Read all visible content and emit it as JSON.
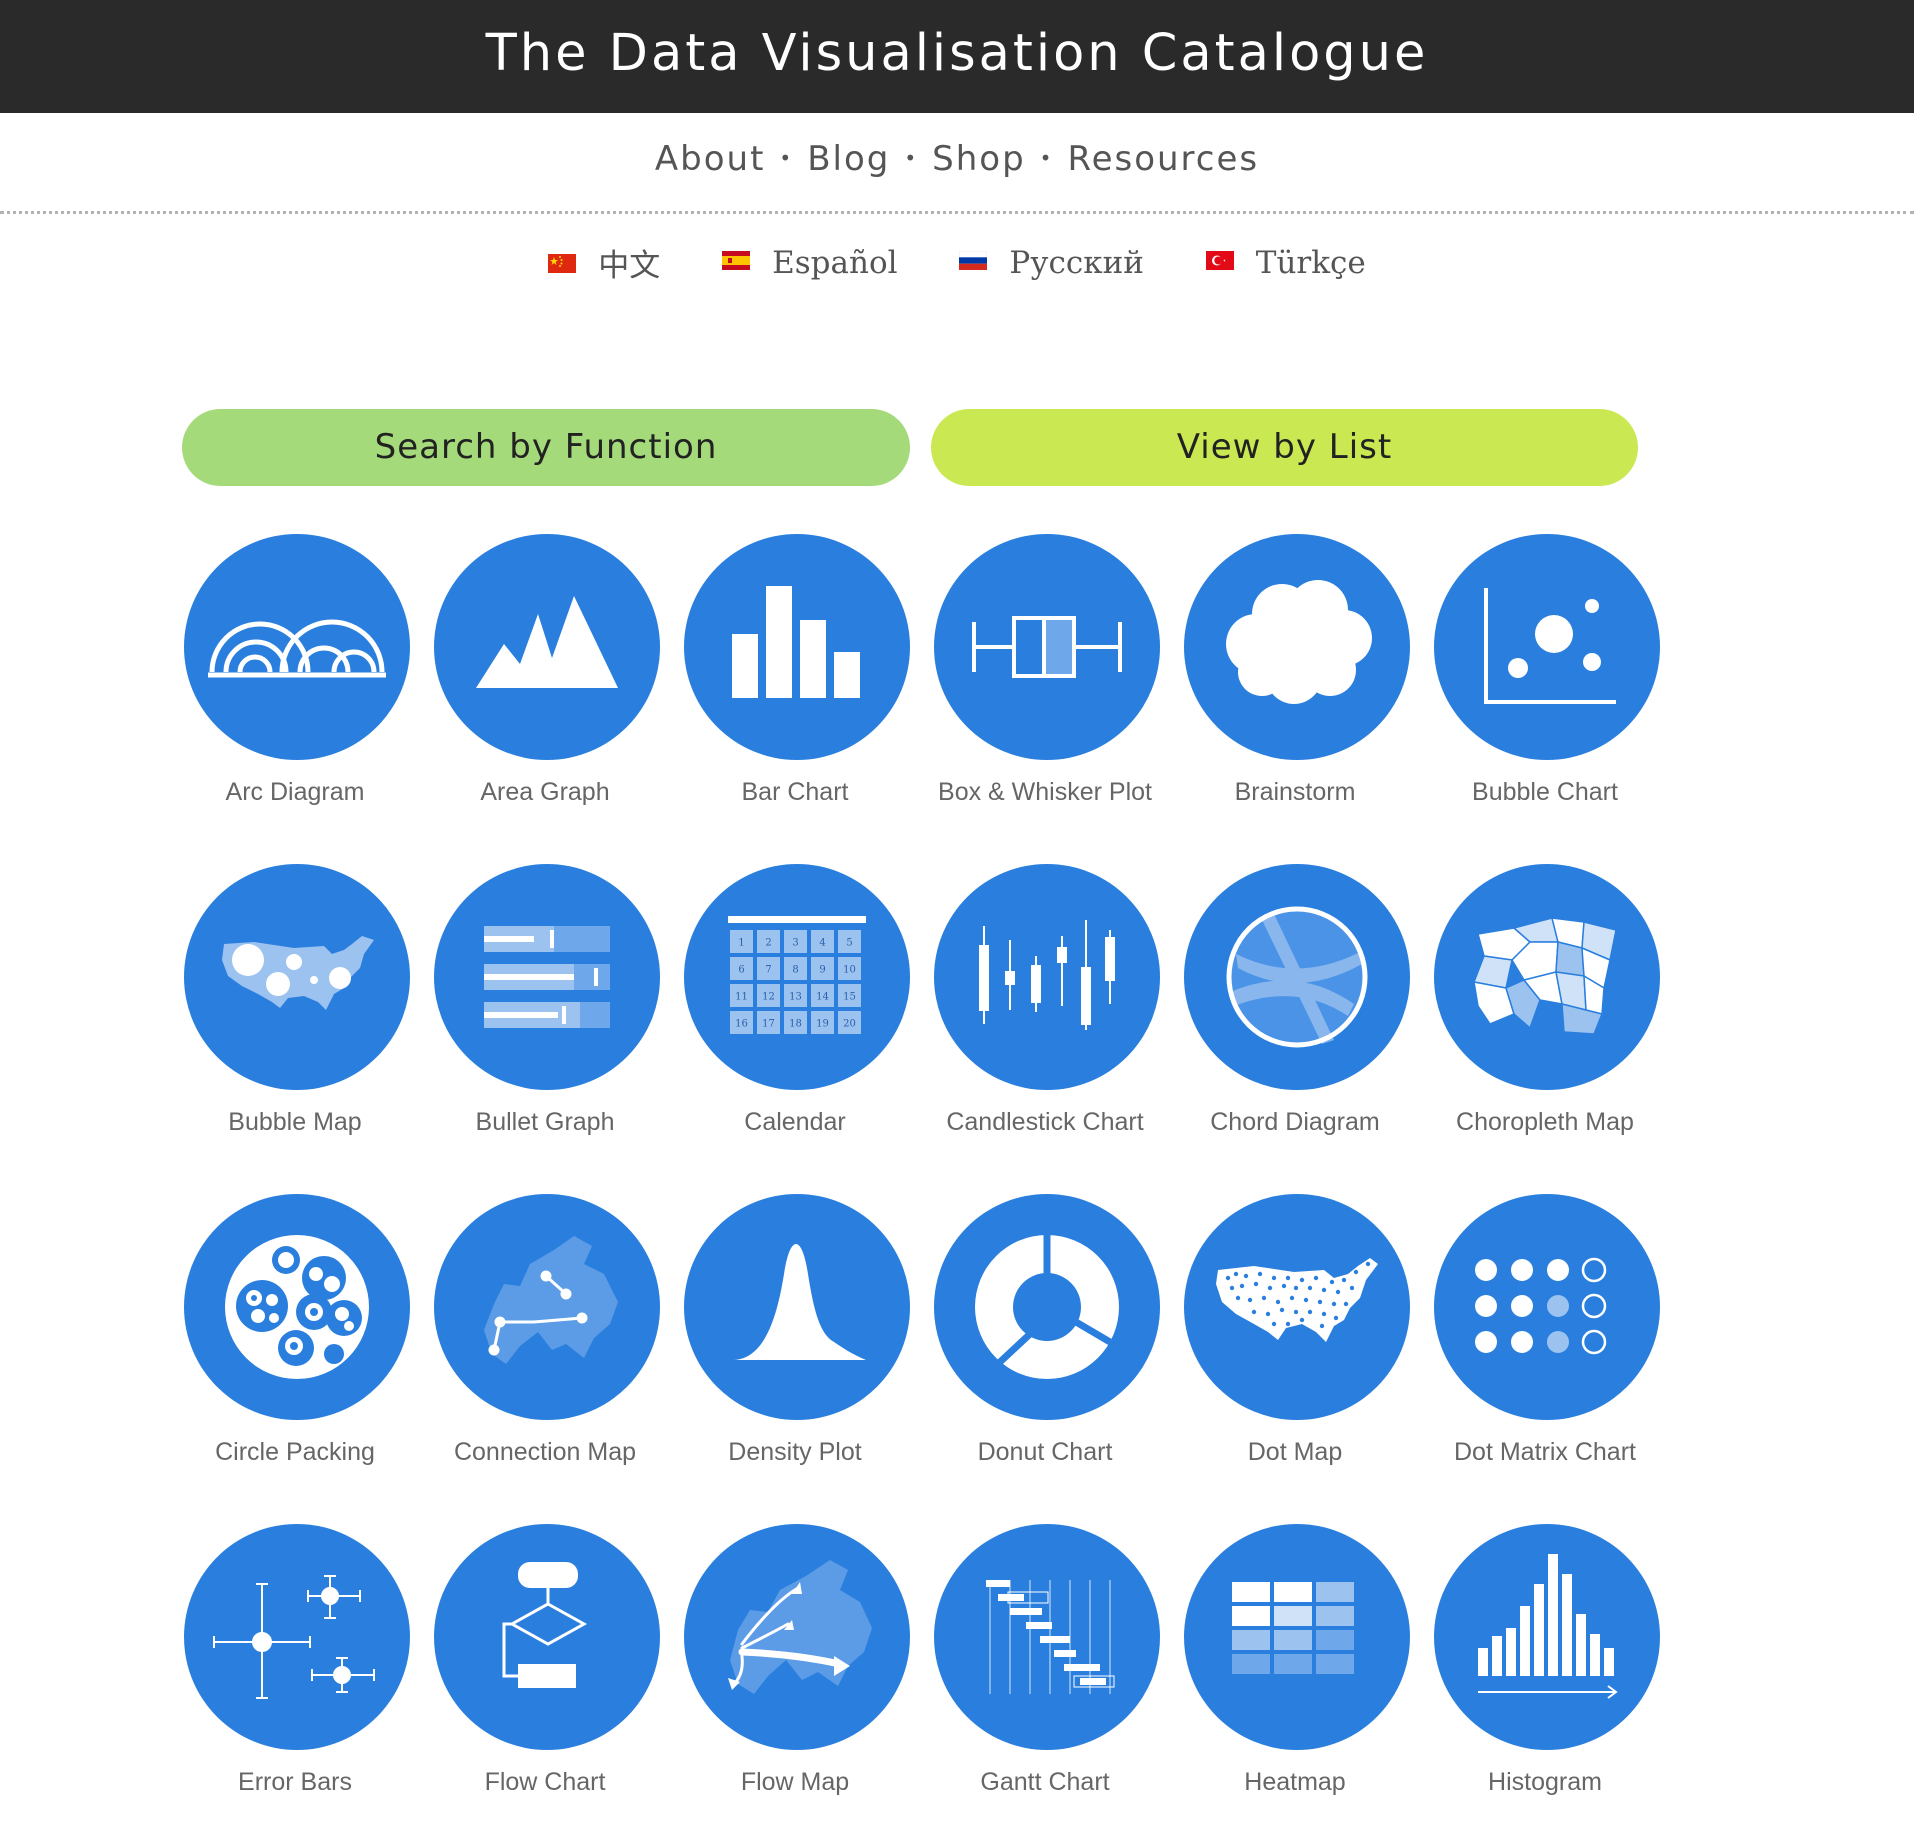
{
  "header": {
    "title": "The Data Visualisation Catalogue"
  },
  "nav": {
    "items": [
      {
        "label": "About"
      },
      {
        "label": "Blog"
      },
      {
        "label": "Shop"
      },
      {
        "label": "Resources"
      }
    ],
    "separator": "•"
  },
  "languages": [
    {
      "label": "中文",
      "flag": "china-flag-icon"
    },
    {
      "label": "Español",
      "flag": "spain-flag-icon"
    },
    {
      "label": "Русский",
      "flag": "russia-flag-icon"
    },
    {
      "label": "Türkçe",
      "flag": "turkey-flag-icon"
    }
  ],
  "buttons": {
    "search_by_function": "Search by Function",
    "view_by_list": "View by List"
  },
  "colors": {
    "header_bg": "#2a2a2a",
    "circle_blue": "#2a7fde",
    "search_button": "#a5da7a",
    "list_button": "#cae851"
  },
  "catalogue": [
    {
      "label": "Arc Diagram",
      "icon": "arc-diagram-icon"
    },
    {
      "label": "Area Graph",
      "icon": "area-graph-icon"
    },
    {
      "label": "Bar Chart",
      "icon": "bar-chart-icon"
    },
    {
      "label": "Box & Whisker Plot",
      "icon": "box-whisker-icon"
    },
    {
      "label": "Brainstorm",
      "icon": "brainstorm-icon"
    },
    {
      "label": "Bubble Chart",
      "icon": "bubble-chart-icon"
    },
    {
      "label": "Bubble Map",
      "icon": "bubble-map-icon"
    },
    {
      "label": "Bullet Graph",
      "icon": "bullet-graph-icon"
    },
    {
      "label": "Calendar",
      "icon": "calendar-icon",
      "days": [
        "1",
        "2",
        "3",
        "4",
        "5",
        "6",
        "7",
        "8",
        "9",
        "10",
        "11",
        "12",
        "13",
        "14",
        "15",
        "16",
        "17",
        "18",
        "19",
        "20"
      ]
    },
    {
      "label": "Candlestick Chart",
      "icon": "candlestick-icon"
    },
    {
      "label": "Chord Diagram",
      "icon": "chord-diagram-icon"
    },
    {
      "label": "Choropleth Map",
      "icon": "choropleth-map-icon"
    },
    {
      "label": "Circle Packing",
      "icon": "circle-packing-icon"
    },
    {
      "label": "Connection Map",
      "icon": "connection-map-icon"
    },
    {
      "label": "Density Plot",
      "icon": "density-plot-icon"
    },
    {
      "label": "Donut Chart",
      "icon": "donut-chart-icon"
    },
    {
      "label": "Dot Map",
      "icon": "dot-map-icon"
    },
    {
      "label": "Dot Matrix Chart",
      "icon": "dot-matrix-icon"
    },
    {
      "label": "Error Bars",
      "icon": "error-bars-icon"
    },
    {
      "label": "Flow Chart",
      "icon": "flow-chart-icon"
    },
    {
      "label": "Flow Map",
      "icon": "flow-map-icon"
    },
    {
      "label": "Gantt Chart",
      "icon": "gantt-chart-icon"
    },
    {
      "label": "Heatmap",
      "icon": "heatmap-icon"
    },
    {
      "label": "Histogram",
      "icon": "histogram-icon"
    }
  ]
}
